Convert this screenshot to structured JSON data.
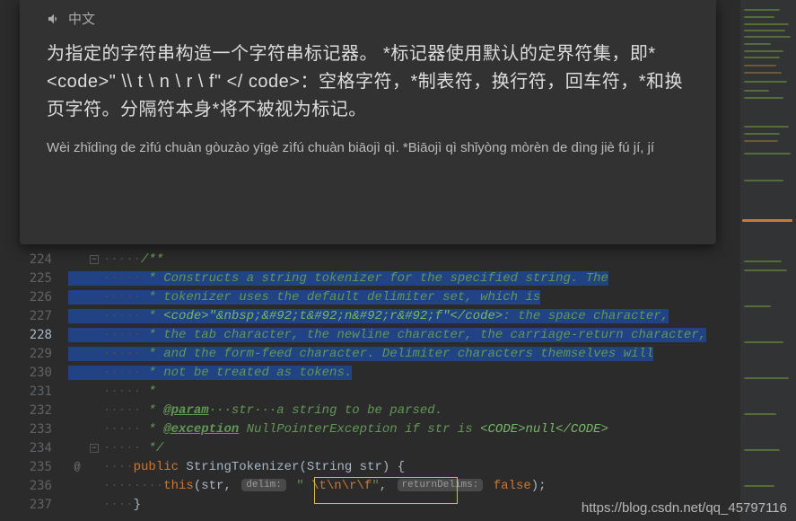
{
  "doc": {
    "lang_label": "中文",
    "text": "为指定的字符串构造一个字符串标记器。 *标记器使用默认的定界符集，即* <code>\" \\\\ t \\ n \\ r \\ f\" </ code>：空格字符，*制表符，换行符，回车符，*和换页字符。分隔符本身*将不被视为标记。",
    "pinyin": "Wèi zhǐdìng de zìfú chuàn gòuzào yīgè zìfú chuàn biāojì qì. *Biāojì qì shǐyòng mòrèn de dìng jiè fú jí, jí"
  },
  "lines": {
    "224": {
      "n": "224",
      "dots": "·····",
      "txt": "/**"
    },
    "225": {
      "n": "225",
      "dots": "·····",
      "txt": " * Constructs a string tokenizer for the specified string. The"
    },
    "226": {
      "n": "226",
      "dots": "·····",
      "txt": " * tokenizer uses the default delimiter set, which is"
    },
    "227": {
      "n": "227",
      "dots": "·····",
      "txt": " * ",
      "code": "<code>\"&nbsp;&#92;t&#92;n&#92;r&#92;f\"</code>",
      "txt2": ": the space character,"
    },
    "228": {
      "n": "228",
      "dots": "·····",
      "txt": " * the tab character, the newline character, the carriage-return character,"
    },
    "229": {
      "n": "229",
      "dots": "·····",
      "txt": " * and the form-feed character. Delimiter characters themselves will"
    },
    "230": {
      "n": "230",
      "dots": "·····",
      "txt": " * not be treated as tokens."
    },
    "231": {
      "n": "231",
      "dots": "·····",
      "txt": " *"
    },
    "232": {
      "n": "232",
      "dots": "·····",
      "txt": " * ",
      "tag": "@param",
      "txt2": "···str···a string to be parsed."
    },
    "233": {
      "n": "233",
      "dots": "·····",
      "txt": " * ",
      "tag": "@exception",
      "txt2": " NullPointerException",
      "txt3": " if str is ",
      "code": "<CODE>null</CODE>"
    },
    "234": {
      "n": "234",
      "dots": "·····",
      "txt": " */"
    },
    "235": {
      "n": "235",
      "dots": "····",
      "kw": "public",
      "cls": " StringTokenizer(",
      "ptype": "String",
      "pname": " str",
      ")": ") {"
    },
    "236": {
      "n": "236",
      "dots": "········",
      "this": "this",
      "p1": "(",
      "pn": "str",
      ",": ", ",
      "h1": "delim:",
      "s": "\" \\t\\n\\r\\f\"",
      ",2": ", ",
      "h2": "returnDelims:",
      "kw2": "false",
      "p2": ");"
    },
    "237": {
      "n": "237",
      "dots": "····",
      "txt": "}"
    }
  },
  "watermark": "https://blog.csdn.net/qq_45797116"
}
